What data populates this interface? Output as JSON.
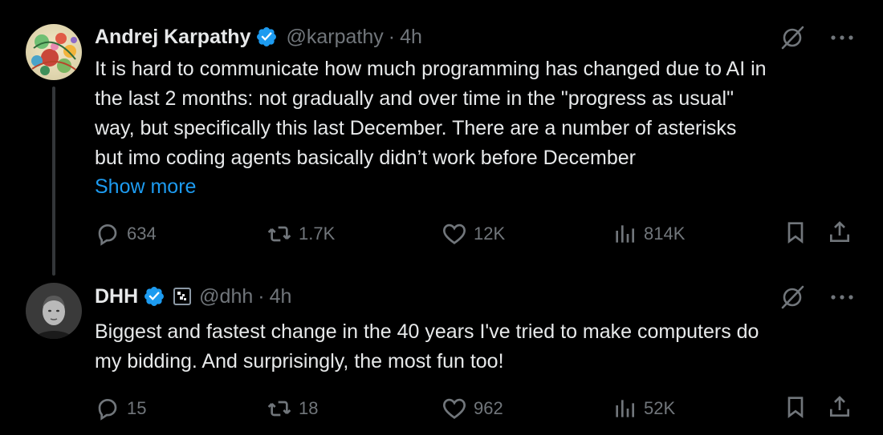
{
  "colors": {
    "background": "#000000",
    "text": "#e7e9ea",
    "muted": "#71767b",
    "link": "#1d9bf0",
    "verified": "#1d9bf0",
    "thread_line": "#333639"
  },
  "tweets": [
    {
      "author": {
        "name": "Andrej Karpathy",
        "handle": "@karpathy",
        "verified": true,
        "verified_icon": "verified-badge-icon"
      },
      "separator": "·",
      "time": "4h",
      "text": "It is hard to communicate how much programming has changed due to AI in\nthe last 2 months: not gradually and over time in the \"progress as usual\"\nway, but specifically this last December. There are a number of asterisks\nbut imo coding agents basically didn’t work before December",
      "show_more": "Show more",
      "stats": {
        "replies": "634",
        "reposts": "1.7K",
        "likes": "12K",
        "views": "814K"
      }
    },
    {
      "author": {
        "name": "DHH",
        "handle": "@dhh",
        "verified": true,
        "verified_icon": "verified-badge-icon",
        "affiliate_icon": "affiliate-badge-icon"
      },
      "separator": "·",
      "time": "4h",
      "text": "Biggest and fastest change in the 40 years I've tried to make computers do\nmy bidding. And surprisingly, the most fun too!",
      "stats": {
        "replies": "15",
        "reposts": "18",
        "likes": "962",
        "views": "52K"
      }
    }
  ]
}
